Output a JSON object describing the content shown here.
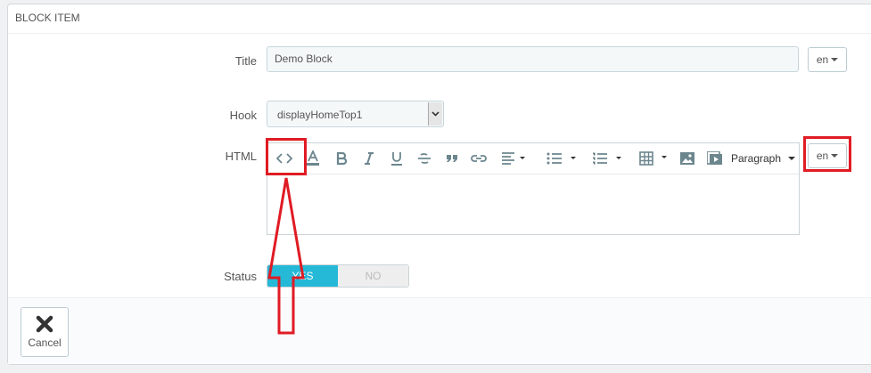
{
  "panel": {
    "title": "BLOCK ITEM"
  },
  "form": {
    "title_label": "Title",
    "title_value": "Demo Block",
    "title_lang": "en",
    "hook_label": "Hook",
    "hook_value": "displayHomeTop1",
    "html_label": "HTML",
    "html_lang": "en",
    "status_label": "Status",
    "status_yes": "YES",
    "status_no": "NO",
    "status_value": "YES"
  },
  "editor": {
    "toolbar_icons": [
      "source-code-icon",
      "font-color-icon",
      "bold-icon",
      "italic-icon",
      "underline-icon",
      "strikethrough-icon",
      "blockquote-icon",
      "link-icon",
      "align-icon",
      "bullet-list-icon",
      "numbered-list-icon",
      "table-icon",
      "image-icon",
      "media-icon"
    ],
    "format_label": "Paragraph",
    "content": ""
  },
  "footer": {
    "cancel_label": "Cancel"
  },
  "colors": {
    "accent": "#25b9d7",
    "annotation": "#e01b24"
  }
}
